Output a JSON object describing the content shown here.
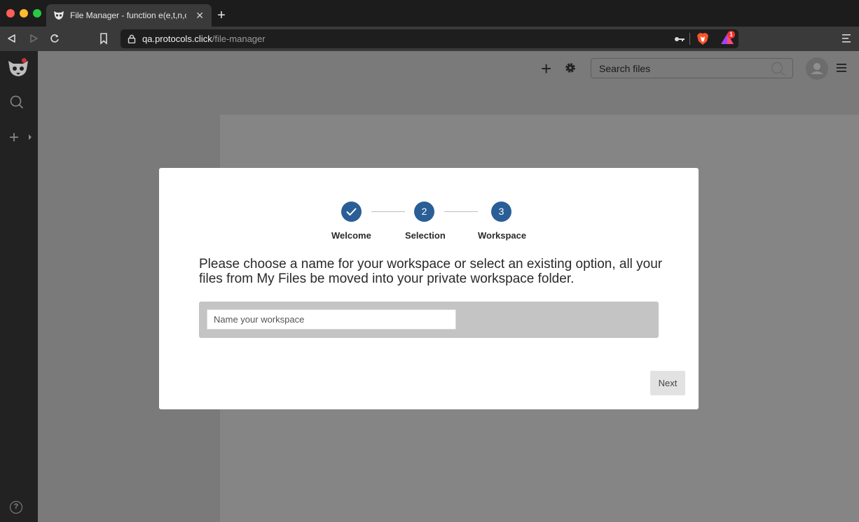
{
  "browser": {
    "tab_title": "File Manager - function e(e,t,n,o,i,",
    "tab_close": "✕",
    "new_tab": "+",
    "url_host": "qa.protocols.click",
    "url_path": "/file-manager",
    "rewards_badge": "1",
    "icons": [
      "tab-favicon-icon",
      "back-icon",
      "forward-icon",
      "reload-icon",
      "bookmark-icon",
      "lock-icon",
      "key-icon",
      "brave-shields-icon",
      "brave-rewards-icon",
      "menu-icon"
    ]
  },
  "sidebar": {
    "icons": [
      "logo-icon",
      "search-icon",
      "add-icon",
      "help-icon"
    ],
    "add_label": "+",
    "help_label": "?"
  },
  "header": {
    "add_label": "+",
    "search_placeholder": "Search files"
  },
  "dialog": {
    "steps": [
      {
        "number": "✓",
        "label": "Welcome"
      },
      {
        "number": "2",
        "label": "Selection"
      },
      {
        "number": "3",
        "label": "Workspace"
      }
    ],
    "instructions": "Please choose a name for your workspace or select an existing option, all your files from My Files be moved into your private workspace folder.",
    "workspace_placeholder": "Name your workspace",
    "next_label": "Next"
  },
  "colors": {
    "accent": "#2a5e96",
    "overlay": "#7a7a7a",
    "sidebar": "#222222"
  }
}
